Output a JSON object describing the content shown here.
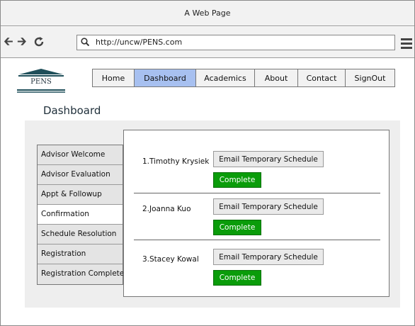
{
  "window": {
    "title": "A Web Page"
  },
  "browser": {
    "url": "http://uncw/PENS.com",
    "icons": {
      "back": "arrow-left-icon",
      "forward": "arrow-right-icon",
      "reload": "reload-icon",
      "search": "search-icon",
      "menu": "hamburger-menu-icon"
    }
  },
  "logo": {
    "text": "PENS"
  },
  "nav": {
    "items": [
      {
        "label": "Home"
      },
      {
        "label": "Dashboard"
      },
      {
        "label": "Academics"
      },
      {
        "label": "About"
      },
      {
        "label": "Contact"
      },
      {
        "label": "SignOut"
      }
    ],
    "active": "Dashboard"
  },
  "page": {
    "title": "Dashboard"
  },
  "sidebar": {
    "items": [
      {
        "label": "Advisor Welcome"
      },
      {
        "label": "Advisor Evaluation"
      },
      {
        "label": "Appt & Followup"
      },
      {
        "label": "Confirmation"
      },
      {
        "label": "Schedule Resolution"
      },
      {
        "label": "Registration"
      },
      {
        "label": "Registration Complete"
      }
    ],
    "active": "Confirmation"
  },
  "students": [
    {
      "name": "1.Timothy Krysiek",
      "email_label": "Email Temporary Schedule",
      "complete_label": "Complete"
    },
    {
      "name": "2.Joanna Kuo",
      "email_label": "Email Temporary Schedule",
      "complete_label": "Complete"
    },
    {
      "name": "3.Stacey Kowal",
      "email_label": "Email Temporary Schedule",
      "complete_label": "Complete"
    }
  ],
  "colors": {
    "nav_active": "#a7c0f0",
    "complete_button": "#0a9c0a",
    "panel_bg": "#eeeeee"
  }
}
